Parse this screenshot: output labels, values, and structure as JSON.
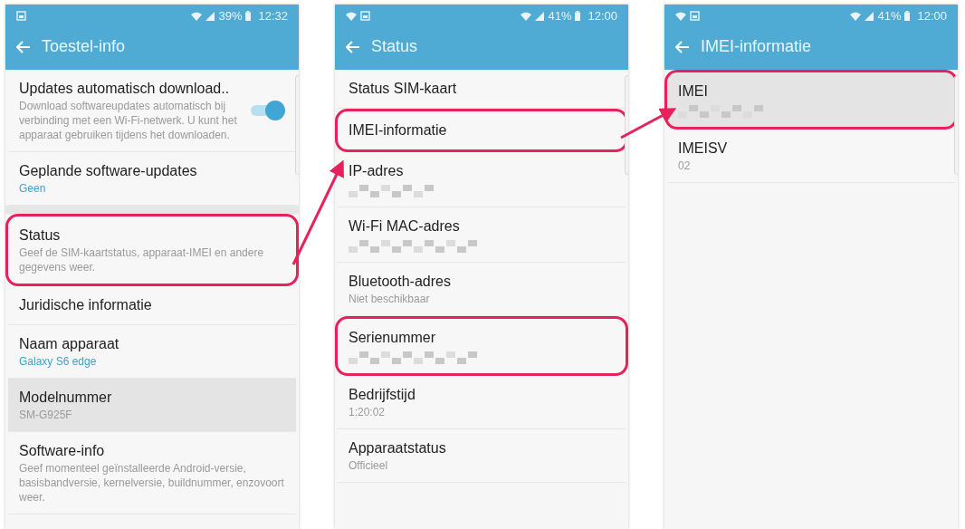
{
  "screens": [
    {
      "status_bar": {
        "left_icons": [
          {
            "kind": "picture"
          }
        ],
        "battery": "39%",
        "time": "12:32"
      },
      "title": "Toestel-info",
      "items": [
        {
          "title": "Updates automatisch download..",
          "subtitle": "Download softwareupdates automatisch bij verbinding met een Wi-Fi-netwerk. U kunt het apparaat gebruiken tijdens het downloaden.",
          "subtitle_accent": false,
          "toggle": {
            "on": true
          },
          "highlighted": false,
          "pressed": false
        },
        {
          "title": "Geplande software-updates",
          "subtitle": "Geen",
          "subtitle_accent": true,
          "highlighted": false,
          "pressed": false
        },
        {
          "title": "Status",
          "subtitle": "Geef de SIM-kaartstatus, apparaat-IMEI en andere gegevens weer.",
          "subtitle_accent": false,
          "highlighted": true,
          "pressed": false,
          "group_start": true
        },
        {
          "title": "Juridische informatie",
          "highlighted": false,
          "pressed": false
        },
        {
          "title": "Naam apparaat",
          "subtitle": "Galaxy S6 edge",
          "subtitle_accent": true,
          "highlighted": false,
          "pressed": false
        },
        {
          "title": "Modelnummer",
          "subtitle": "SM-G925F",
          "subtitle_accent": false,
          "highlighted": false,
          "pressed": true
        },
        {
          "title": "Software-info",
          "subtitle": "Geef momenteel geïnstalleerde Android-versie, basisbandversie, kernelversie, buildnummer, enzovoort weer.",
          "subtitle_accent": false,
          "highlighted": false,
          "pressed": false
        }
      ]
    },
    {
      "status_bar": {
        "left_icons": [
          {
            "kind": "wifi"
          },
          {
            "kind": "picture"
          }
        ],
        "battery": "41%",
        "time": "12:00"
      },
      "title": "Status",
      "items": [
        {
          "title": "Status SIM-kaart",
          "highlighted": false,
          "pressed": false
        },
        {
          "title": "IMEI-informatie",
          "highlighted": true,
          "pressed": false
        },
        {
          "title": "IP-adres",
          "highlighted": false,
          "pressed": false,
          "value_hidden": true
        },
        {
          "title": "Wi-Fi MAC-adres",
          "highlighted": false,
          "pressed": false,
          "value_hidden": true
        },
        {
          "title": "Bluetooth-adres",
          "subtitle": "Niet beschikbaar",
          "subtitle_accent": false,
          "highlighted": false,
          "pressed": false
        },
        {
          "title": "Serienummer",
          "highlighted": true,
          "pressed": false,
          "value_hidden": true
        },
        {
          "title": "Bedrijfstijd",
          "subtitle": "1:20:02",
          "subtitle_accent": false,
          "highlighted": false,
          "pressed": false
        },
        {
          "title": "Apparaatstatus",
          "subtitle": "Officieel",
          "subtitle_accent": false,
          "highlighted": false,
          "pressed": false
        }
      ]
    },
    {
      "status_bar": {
        "left_icons": [
          {
            "kind": "wifi"
          },
          {
            "kind": "picture"
          }
        ],
        "battery": "41%",
        "time": "12:00"
      },
      "title": "IMEI-informatie",
      "items": [
        {
          "title": "IMEI",
          "highlighted": true,
          "pressed": true,
          "value_hidden": true
        },
        {
          "title": "IMEISV",
          "subtitle": "02",
          "subtitle_accent": false,
          "highlighted": false,
          "pressed": false
        }
      ]
    }
  ]
}
